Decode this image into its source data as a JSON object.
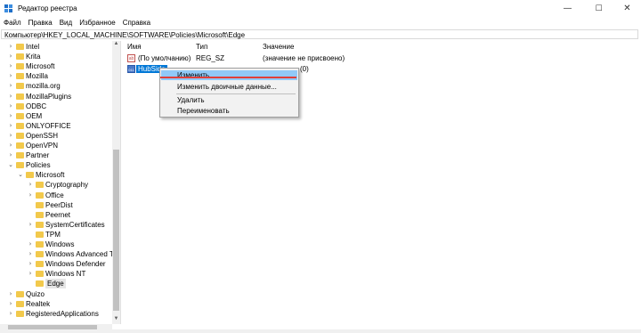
{
  "window": {
    "title": "Редактор реестра",
    "minimize": "—",
    "maximize": "☐",
    "close": "✕"
  },
  "menu": [
    "Файл",
    "Правка",
    "Вид",
    "Избранное",
    "Справка"
  ],
  "address": "Компьютер\\HKEY_LOCAL_MACHINE\\SOFTWARE\\Policies\\Microsoft\\Edge",
  "tree": [
    {
      "label": "Intel",
      "level": 0,
      "arrow": "›"
    },
    {
      "label": "Krita",
      "level": 0,
      "arrow": "›"
    },
    {
      "label": "Microsoft",
      "level": 0,
      "arrow": "›"
    },
    {
      "label": "Mozilla",
      "level": 0,
      "arrow": "›"
    },
    {
      "label": "mozilla.org",
      "level": 0,
      "arrow": "›"
    },
    {
      "label": "MozillaPlugins",
      "level": 0,
      "arrow": "›"
    },
    {
      "label": "ODBC",
      "level": 0,
      "arrow": "›"
    },
    {
      "label": "OEM",
      "level": 0,
      "arrow": "›"
    },
    {
      "label": "ONLYOFFICE",
      "level": 0,
      "arrow": "›"
    },
    {
      "label": "OpenSSH",
      "level": 0,
      "arrow": "›"
    },
    {
      "label": "OpenVPN",
      "level": 0,
      "arrow": "›"
    },
    {
      "label": "Partner",
      "level": 0,
      "arrow": "›"
    },
    {
      "label": "Policies",
      "level": 0,
      "arrow": "⌄"
    },
    {
      "label": "Microsoft",
      "level": 1,
      "arrow": "⌄"
    },
    {
      "label": "Cryptography",
      "level": 2,
      "arrow": "›"
    },
    {
      "label": "Office",
      "level": 2,
      "arrow": "›"
    },
    {
      "label": "PeerDist",
      "level": 2,
      "arrow": ""
    },
    {
      "label": "Peernet",
      "level": 2,
      "arrow": ""
    },
    {
      "label": "SystemCertificates",
      "level": 2,
      "arrow": "›"
    },
    {
      "label": "TPM",
      "level": 2,
      "arrow": ""
    },
    {
      "label": "Windows",
      "level": 2,
      "arrow": "›"
    },
    {
      "label": "Windows Advanced Th",
      "level": 2,
      "arrow": "›"
    },
    {
      "label": "Windows Defender",
      "level": 2,
      "arrow": "›"
    },
    {
      "label": "Windows NT",
      "level": 2,
      "arrow": "›"
    },
    {
      "label": "Edge",
      "level": 2,
      "arrow": "",
      "selected": true
    },
    {
      "label": "Quizo",
      "level": 0,
      "arrow": "›"
    },
    {
      "label": "Realtek",
      "level": 0,
      "arrow": "›"
    },
    {
      "label": "RegisteredApplications",
      "level": 0,
      "arrow": "›"
    }
  ],
  "columns": {
    "name": "Имя",
    "type": "Тип",
    "value": "Значение"
  },
  "values": [
    {
      "name": "(По умолчанию)",
      "type": "REG_SZ",
      "data": "(значение не присвоено)",
      "icon": "ab"
    },
    {
      "name": "HubSide",
      "type": "",
      "data": "(0)",
      "icon": "bin",
      "selected": true
    }
  ],
  "context_menu": {
    "edit": "Изменить...",
    "edit_binary": "Изменить двоичные данные...",
    "delete": "Удалить",
    "rename": "Переименовать"
  },
  "colors": {
    "accent": "#0078d7",
    "highlight": "#91c9f7",
    "underline": "#e0403a"
  }
}
